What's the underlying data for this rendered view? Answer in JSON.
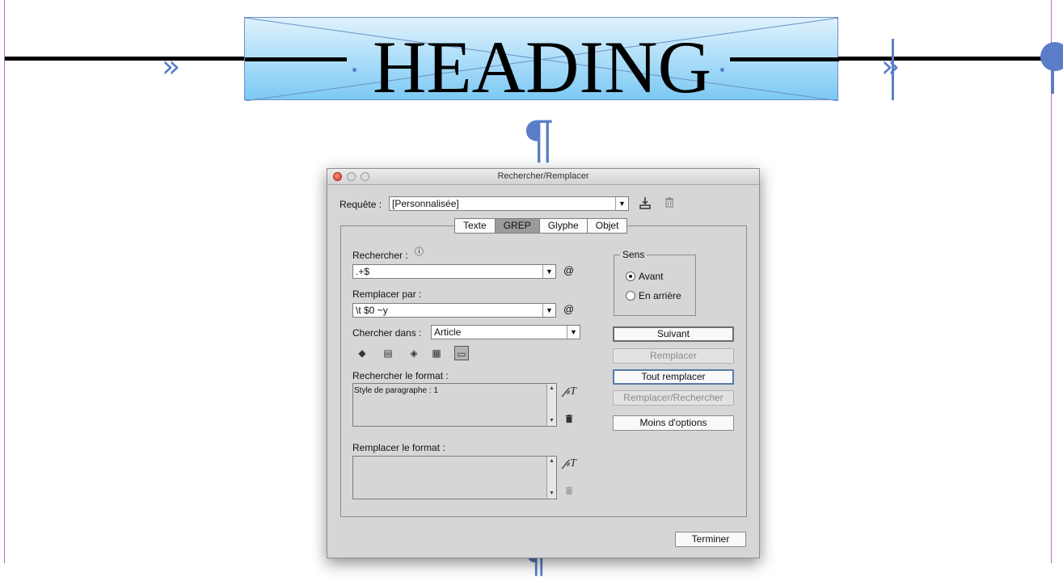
{
  "document": {
    "heading_text": "HEADING",
    "tab_glyph": "»",
    "pilcrow_glyph": "¶",
    "accent_color": "#5b7dc8"
  },
  "dialog": {
    "title": "Rechercher/Remplacer",
    "query_label": "Requête :",
    "query_value": "[Personnalisée]",
    "tabs": [
      {
        "label": "Texte",
        "active": false
      },
      {
        "label": "GREP",
        "active": true
      },
      {
        "label": "Glyphe",
        "active": false
      },
      {
        "label": "Objet",
        "active": false
      }
    ],
    "find_label": "Rechercher :",
    "find_value": ".+$",
    "replace_label": "Remplacer par :",
    "replace_value": "\\t $0 ~y",
    "search_in_label": "Chercher dans :",
    "search_in_value": "Article",
    "find_format_label": "Rechercher le format :",
    "find_format_value": "Style de paragraphe : 1",
    "replace_format_label": "Remplacer le format :",
    "replace_format_value": "",
    "direction": {
      "legend": "Sens",
      "forward_label": "Avant",
      "backward_label": "En arrière",
      "selected": "forward"
    },
    "buttons": {
      "next": "Suivant",
      "replace": "Remplacer",
      "replace_all": "Tout remplacer",
      "replace_find": "Remplacer/Rechercher",
      "fewer_options": "Moins d'options",
      "done": "Terminer"
    },
    "special_char_symbol": "@",
    "info_symbol": "ⓘ"
  }
}
